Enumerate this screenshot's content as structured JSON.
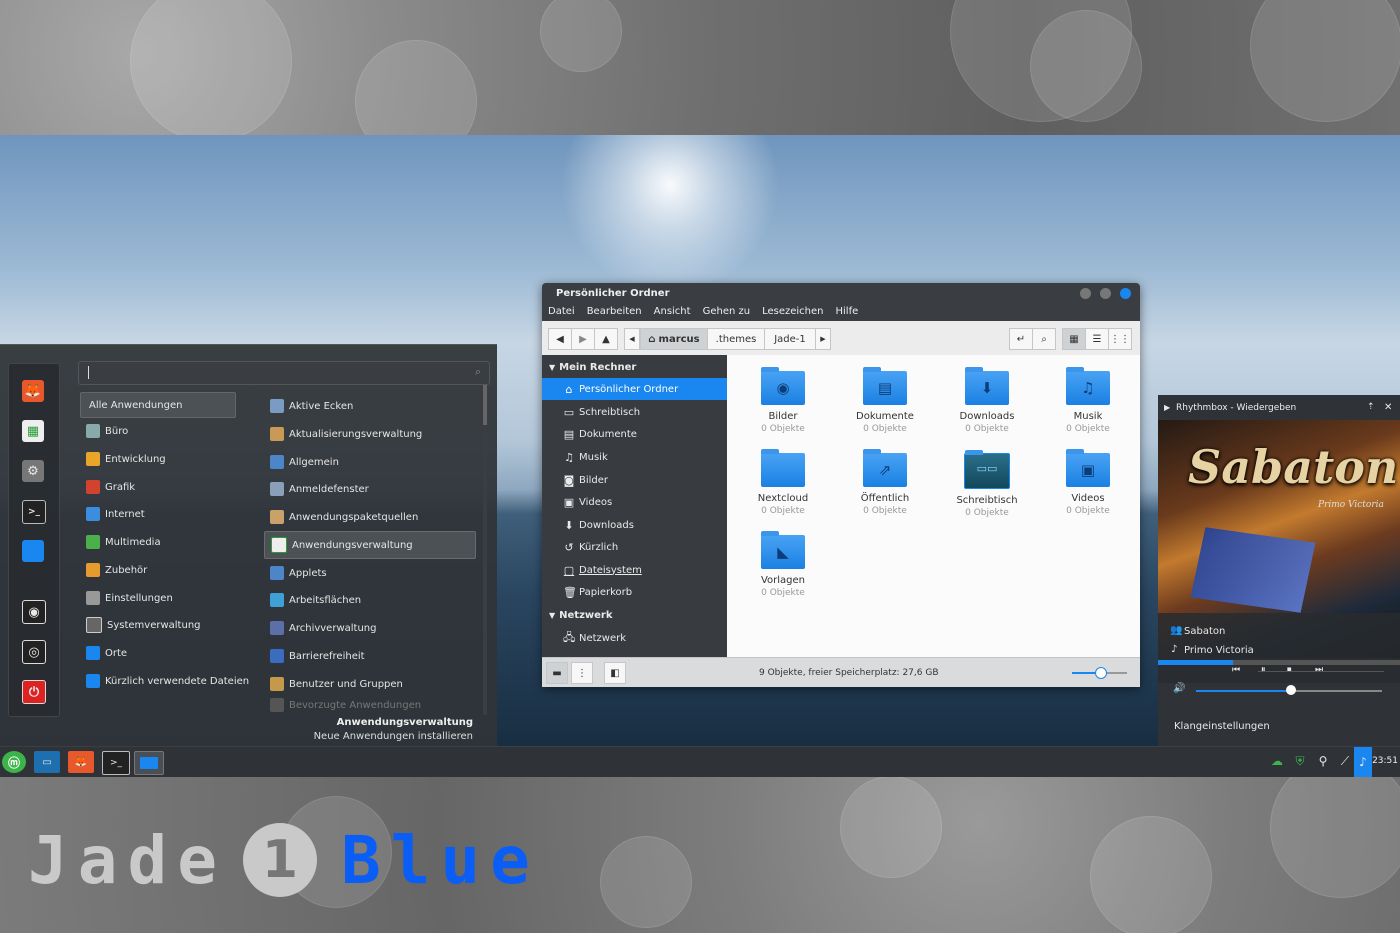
{
  "branding": {
    "word1": "Jade",
    "number": "1",
    "word2": "Blue"
  },
  "menu": {
    "search_placeholder": "",
    "categories": [
      "Alle Anwendungen",
      "Büro",
      "Entwicklung",
      "Grafik",
      "Internet",
      "Multimedia",
      "Zubehör",
      "Einstellungen",
      "Systemverwaltung",
      "Orte",
      "Kürzlich verwendete Dateien"
    ],
    "apps": [
      "Aktive Ecken",
      "Aktualisierungsverwaltung",
      "Allgemein",
      "Anmeldefenster",
      "Anwendungspaketquellen",
      "Anwendungsverwaltung",
      "Applets",
      "Arbeitsflächen",
      "Archivverwaltung",
      "Barrierefreiheit",
      "Benutzer und Gruppen",
      "Bevorzugte Anwendungen"
    ],
    "selected_app": "Anwendungsverwaltung",
    "description_title": "Anwendungsverwaltung",
    "description_text": "Neue Anwendungen installieren"
  },
  "file_manager": {
    "title": "Persönlicher Ordner",
    "menubar": [
      "Datei",
      "Bearbeiten",
      "Ansicht",
      "Gehen zu",
      "Lesezeichen",
      "Hilfe"
    ],
    "path": [
      "marcus",
      ".themes",
      "Jade-1"
    ],
    "sidebar": {
      "computer_header": "Mein Rechner",
      "computer_items": [
        "Persönlicher Ordner",
        "Schreibtisch",
        "Dokumente",
        "Musik",
        "Bilder",
        "Videos",
        "Downloads",
        "Kürzlich",
        "Dateisystem",
        "Papierkorb"
      ],
      "network_header": "Netzwerk",
      "network_items": [
        "Netzwerk"
      ]
    },
    "folders": [
      {
        "name": "Bilder",
        "info": "0 Objekte",
        "icon": "camera-icon"
      },
      {
        "name": "Dokumente",
        "info": "0 Objekte",
        "icon": "document-icon"
      },
      {
        "name": "Downloads",
        "info": "0 Objekte",
        "icon": "download-icon"
      },
      {
        "name": "Musik",
        "info": "0 Objekte",
        "icon": "music-icon"
      },
      {
        "name": "Nextcloud",
        "info": "0 Objekte",
        "icon": "cloud-icon"
      },
      {
        "name": "Öffentlich",
        "info": "0 Objekte",
        "icon": "share-icon"
      },
      {
        "name": "Schreibtisch",
        "info": "0 Objekte",
        "icon": "desktop-icon"
      },
      {
        "name": "Videos",
        "info": "0 Objekte",
        "icon": "film-icon"
      },
      {
        "name": "Vorlagen",
        "info": "0 Objekte",
        "icon": "template-icon"
      }
    ],
    "status": "9 Objekte, freier Speicherplatz: 27,6 GB",
    "zoom_level": 0.5
  },
  "rhythmbox": {
    "title": "Rhythmbox - Wiedergeben",
    "album_logo": "Sabaton",
    "album_subtitle": "Primo Victoria",
    "artist": "Sabaton",
    "album": "Primo Victoria",
    "progress": 0.31,
    "volume": 0.51,
    "settings_label": "Klangeinstellungen"
  },
  "panel": {
    "clock": "23:51"
  },
  "colors": {
    "accent": "#1a86ef",
    "brand_blue": "#0b5ef5"
  }
}
